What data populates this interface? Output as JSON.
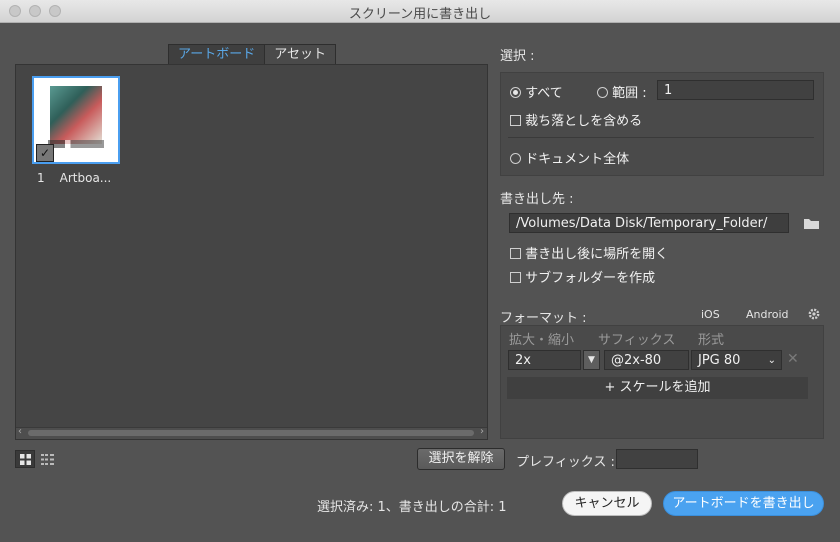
{
  "window": {
    "title": "スクリーン用に書き出し"
  },
  "tabs": [
    {
      "label": "アートボード"
    },
    {
      "label": "アセット"
    }
  ],
  "artboards": [
    {
      "number": "1",
      "name": "Artboa..."
    }
  ],
  "selection": {
    "label": "選択 :",
    "all_label": "すべて",
    "range_label": "範囲 :",
    "range_value": "1",
    "include_bleed_label": "裁ち落としを含める",
    "full_document_label": "ドキュメント全体"
  },
  "export_to": {
    "label": "書き出し先 :",
    "path": "/Volumes/Data Disk/Temporary_Folder/",
    "open_after_label": "書き出し後に場所を開く",
    "create_subfolders_label": "サブフォルダーを作成"
  },
  "formats": {
    "label": "フォーマット :",
    "presets": [
      "iOS",
      "Android"
    ],
    "columns": [
      "拡大・縮小",
      "サフィックス",
      "形式"
    ],
    "rows": [
      {
        "scale": "2x",
        "suffix": "@2x-80",
        "format": "JPG 80"
      }
    ],
    "add_scale_label": "+ スケールを追加"
  },
  "bottom": {
    "deselect_label": "選択を解除",
    "prefix_label": "プレフィックス :",
    "prefix_value": "",
    "status": "選択済み: 1、書き出しの合計: 1",
    "cancel_label": "キャンセル",
    "export_label": "アートボードを書き出し"
  },
  "colors": {
    "accent": "#4aa2f0",
    "background": "#535353"
  }
}
